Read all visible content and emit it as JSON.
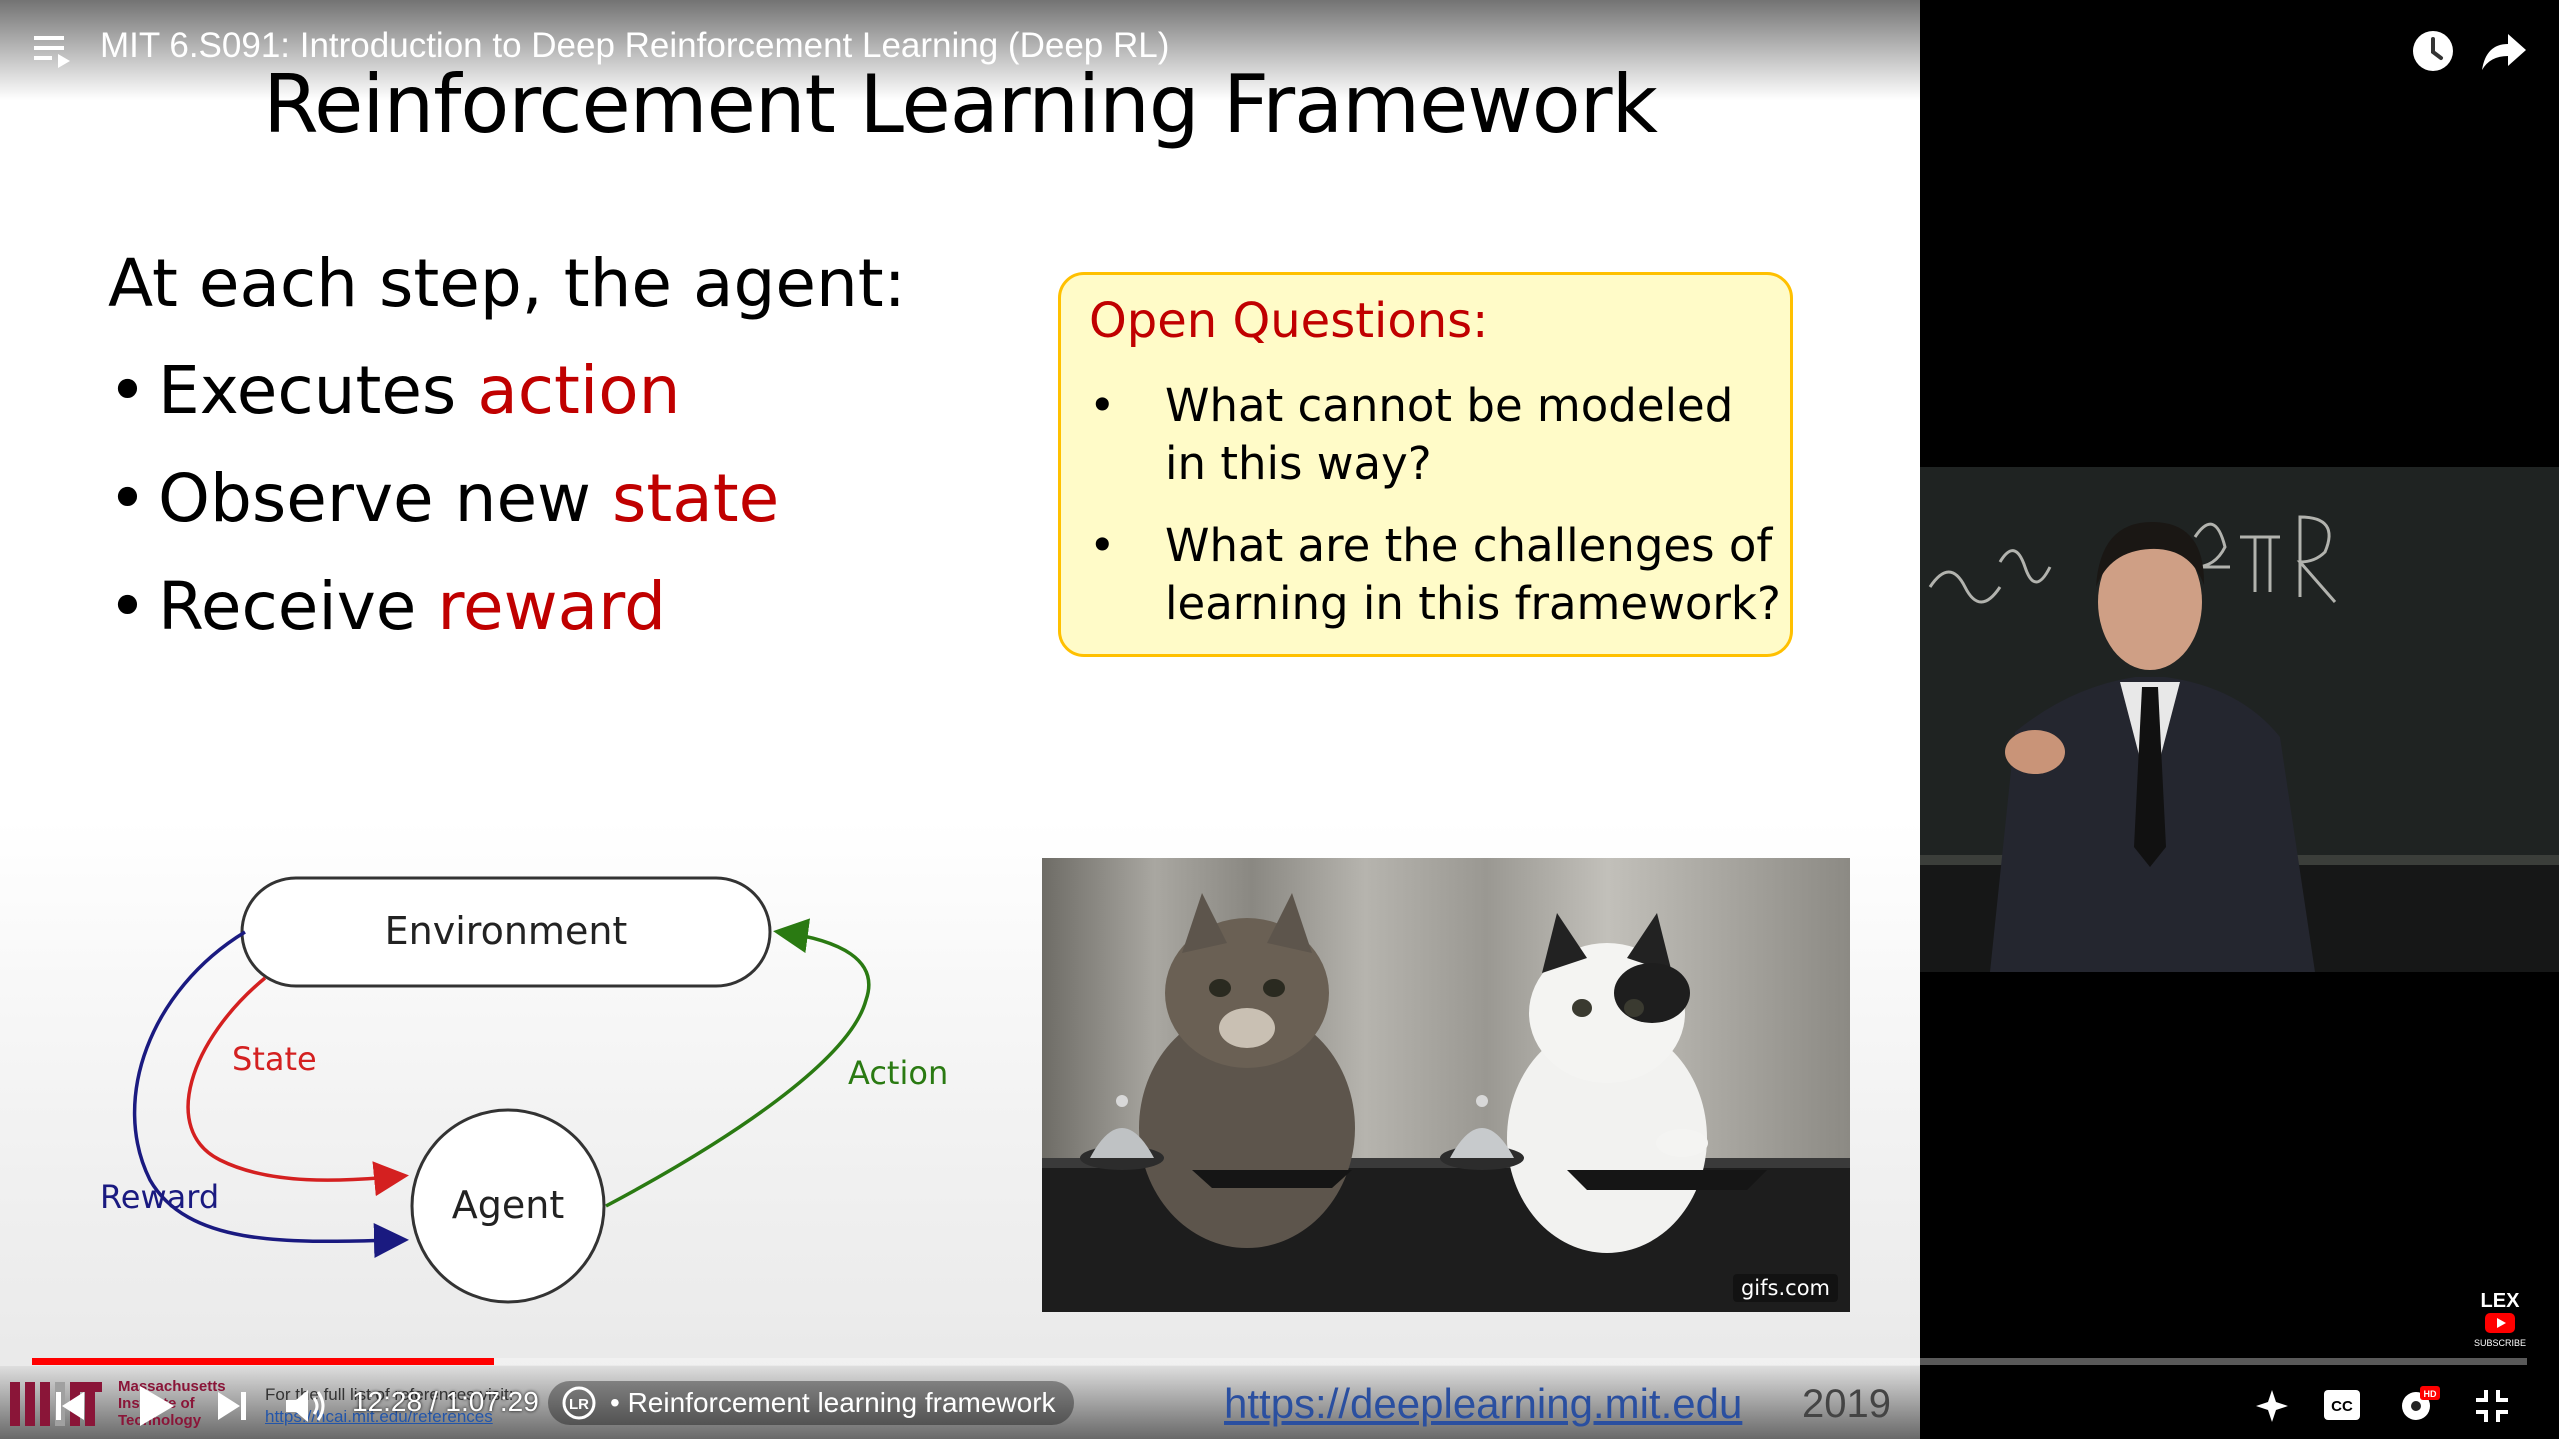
{
  "top_bar": {
    "video_title": "MIT 6.S091: Introduction to Deep Reinforcement Learning (Deep RL)"
  },
  "slide": {
    "title": "Reinforcement Learning Framework",
    "intro": "At each step, the agent:",
    "bullets": [
      {
        "text": "Executes ",
        "highlight": "action"
      },
      {
        "text": "Observe new ",
        "highlight": "state"
      },
      {
        "text": "Receive ",
        "highlight": "reward"
      }
    ],
    "open_questions": {
      "title": "Open Questions:",
      "items": [
        "What cannot be modeled in this way?",
        "What are the challenges of learning in this framework?"
      ]
    },
    "diagram": {
      "environment": "Environment",
      "agent": "Agent",
      "state": "State",
      "reward": "Reward",
      "action": "Action"
    },
    "image_watermark": "gifs.com"
  },
  "footer": {
    "mit_name": "Massachusetts Institute of Technology",
    "references_text": "For the full list of references visit:",
    "references_link": "https://hcai.mit.edu/references",
    "course_url": "https://deeplearning.mit.edu",
    "year": "2019"
  },
  "player": {
    "current_time": "12:28",
    "duration": "1:07:29",
    "time_display": "12:28 / 1:07:29",
    "chapter": "• Reinforcement learning framework",
    "progress_fraction": 0.185,
    "accent_color": "#ff0000"
  },
  "channel_badge": {
    "name": "LEX",
    "subscribe": "SUBSCRIBE"
  },
  "colors": {
    "highlight_red": "#c00000",
    "box_fill": "#fffbc8",
    "box_border": "#ffc000",
    "state_arrow": "#d42020",
    "reward_arrow": "#1a1a80",
    "action_arrow": "#2a7a12"
  }
}
